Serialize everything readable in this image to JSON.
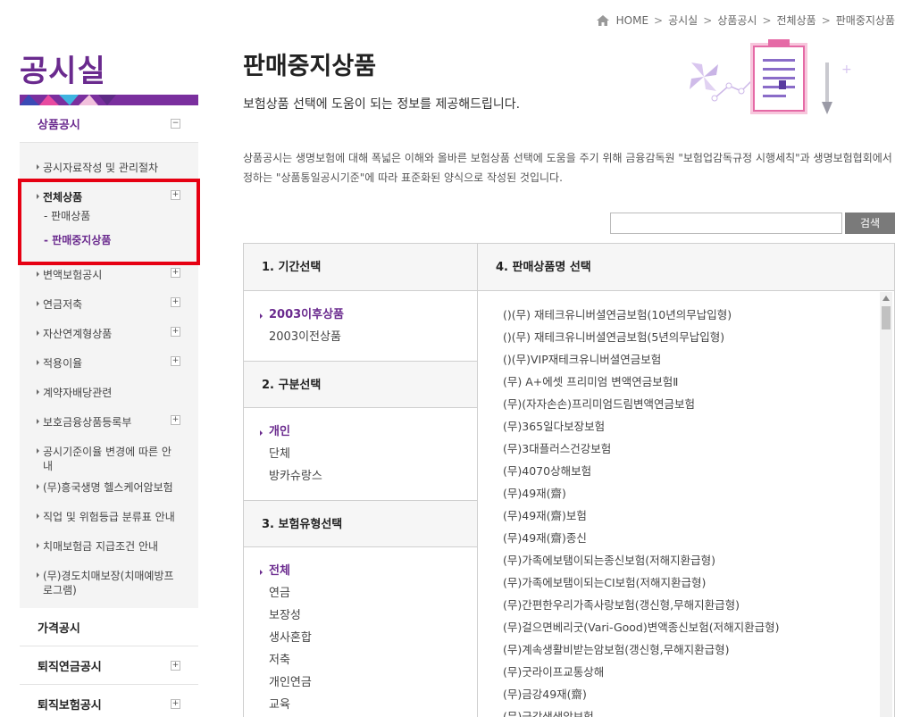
{
  "breadcrumb": {
    "items": [
      "HOME",
      "공시실",
      "상품공시",
      "전체상품",
      "판매중지상품"
    ],
    "sep": ">"
  },
  "sidebar": {
    "title": "공시실",
    "top_menu": "상품공시",
    "items": [
      {
        "label": "공시자료작성 및 관리절차",
        "plus": false
      },
      {
        "label": "전체상품",
        "plus": true,
        "active": true
      },
      {
        "label": "변액보험공시",
        "plus": true
      },
      {
        "label": "연금저축",
        "plus": true
      },
      {
        "label": "자산연계형상품",
        "plus": true
      },
      {
        "label": "적용이율",
        "plus": true
      },
      {
        "label": "계약자배당관련",
        "plus": false
      },
      {
        "label": "보호금융상품등록부",
        "plus": true
      },
      {
        "label": "공시기준이율 변경에 따른 안내",
        "plus": false
      },
      {
        "label": "(무)흥국생명 헬스케어암보험",
        "plus": false
      },
      {
        "label": "직업 및 위험등급 분류표 안내",
        "plus": false
      },
      {
        "label": "치매보험금 지급조건 안내",
        "plus": false
      },
      {
        "label": "(무)경도치매보장(치매예방프로그램)",
        "plus": false
      }
    ],
    "subsub": [
      "- 판매상품",
      "- 판매중지상품"
    ],
    "bottom_menus": [
      "가격공시",
      "퇴직연금공시",
      "퇴직보험공시"
    ],
    "plus_glyph": "+",
    "minus_glyph": "−"
  },
  "main": {
    "title": "판매중지상품",
    "subtitle": "보험상품 선택에 도움이 되는 정보를 제공해드립니다.",
    "description": "상품공시는 생명보험에 대해 폭넓은 이해와 올바른 보험상품 선택에 도움을 주기 위해 금융감독원 \"보험업감독규정 시행세칙\"과 생명보험협회에서 정하는 \"상품통일공시기준\"에 따라 표준화된 양식으로 작성된 것입니다.",
    "search": {
      "value": "",
      "button": "검색"
    }
  },
  "selector": {
    "sec1": {
      "head": "1. 기간선택",
      "options": [
        "2003이후상품",
        "2003이전상품"
      ]
    },
    "sec2": {
      "head": "2. 구분선택",
      "options": [
        "개인",
        "단체",
        "방카슈랑스"
      ]
    },
    "sec3": {
      "head": "3. 보험유형선택",
      "options": [
        "전체",
        "연금",
        "보장성",
        "생사혼합",
        "저축",
        "개인연금",
        "교육"
      ]
    },
    "sec4": {
      "head": "4. 판매상품명 선택"
    },
    "products": [
      "()(무) 재테크유니버셜연금보험(10년의무납입형)",
      "()(무) 재테크유니버셜연금보험(5년의무납입형)",
      "()(무)VIP재테크유니버셜연금보험",
      "(무) A+에셋 프리미엄 변액연금보험Ⅱ",
      "(무)(자자손손)프리미엄드림변액연금보험",
      "(무)365일다보장보험",
      "(무)3대플러스건강보험",
      "(무)4070상해보험",
      "(무)49재(齋)",
      "(무)49재(齋)보험",
      "(무)49재(齋)종신",
      "(무)가족에보탬이되는종신보험(저해지환급형)",
      "(무)가족에보탬이되는CI보험(저해지환급형)",
      "(무)간편한우리가족사랑보험(갱신형,무해지환급형)",
      "(무)걸으면베리굿(Vari-Good)변액종신보험(저해지환급형)",
      "(무)계속생활비받는암보험(갱신형,무해지환급형)",
      "(무)굿라이프교통상해",
      "(무)금강49재(齋)",
      "(무)금강생생암보험"
    ]
  },
  "colors": {
    "brand": "#6a2a8e",
    "highlight_border": "#e60012"
  }
}
